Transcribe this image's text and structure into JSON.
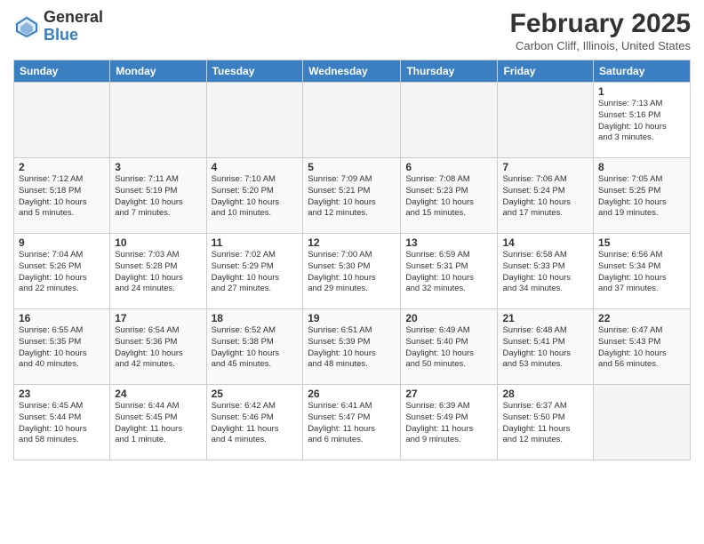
{
  "logo": {
    "general": "General",
    "blue": "Blue"
  },
  "title": {
    "month": "February 2025",
    "location": "Carbon Cliff, Illinois, United States"
  },
  "headers": [
    "Sunday",
    "Monday",
    "Tuesday",
    "Wednesday",
    "Thursday",
    "Friday",
    "Saturday"
  ],
  "weeks": [
    [
      {
        "num": "",
        "info": ""
      },
      {
        "num": "",
        "info": ""
      },
      {
        "num": "",
        "info": ""
      },
      {
        "num": "",
        "info": ""
      },
      {
        "num": "",
        "info": ""
      },
      {
        "num": "",
        "info": ""
      },
      {
        "num": "1",
        "info": "Sunrise: 7:13 AM\nSunset: 5:16 PM\nDaylight: 10 hours\nand 3 minutes."
      }
    ],
    [
      {
        "num": "2",
        "info": "Sunrise: 7:12 AM\nSunset: 5:18 PM\nDaylight: 10 hours\nand 5 minutes."
      },
      {
        "num": "3",
        "info": "Sunrise: 7:11 AM\nSunset: 5:19 PM\nDaylight: 10 hours\nand 7 minutes."
      },
      {
        "num": "4",
        "info": "Sunrise: 7:10 AM\nSunset: 5:20 PM\nDaylight: 10 hours\nand 10 minutes."
      },
      {
        "num": "5",
        "info": "Sunrise: 7:09 AM\nSunset: 5:21 PM\nDaylight: 10 hours\nand 12 minutes."
      },
      {
        "num": "6",
        "info": "Sunrise: 7:08 AM\nSunset: 5:23 PM\nDaylight: 10 hours\nand 15 minutes."
      },
      {
        "num": "7",
        "info": "Sunrise: 7:06 AM\nSunset: 5:24 PM\nDaylight: 10 hours\nand 17 minutes."
      },
      {
        "num": "8",
        "info": "Sunrise: 7:05 AM\nSunset: 5:25 PM\nDaylight: 10 hours\nand 19 minutes."
      }
    ],
    [
      {
        "num": "9",
        "info": "Sunrise: 7:04 AM\nSunset: 5:26 PM\nDaylight: 10 hours\nand 22 minutes."
      },
      {
        "num": "10",
        "info": "Sunrise: 7:03 AM\nSunset: 5:28 PM\nDaylight: 10 hours\nand 24 minutes."
      },
      {
        "num": "11",
        "info": "Sunrise: 7:02 AM\nSunset: 5:29 PM\nDaylight: 10 hours\nand 27 minutes."
      },
      {
        "num": "12",
        "info": "Sunrise: 7:00 AM\nSunset: 5:30 PM\nDaylight: 10 hours\nand 29 minutes."
      },
      {
        "num": "13",
        "info": "Sunrise: 6:59 AM\nSunset: 5:31 PM\nDaylight: 10 hours\nand 32 minutes."
      },
      {
        "num": "14",
        "info": "Sunrise: 6:58 AM\nSunset: 5:33 PM\nDaylight: 10 hours\nand 34 minutes."
      },
      {
        "num": "15",
        "info": "Sunrise: 6:56 AM\nSunset: 5:34 PM\nDaylight: 10 hours\nand 37 minutes."
      }
    ],
    [
      {
        "num": "16",
        "info": "Sunrise: 6:55 AM\nSunset: 5:35 PM\nDaylight: 10 hours\nand 40 minutes."
      },
      {
        "num": "17",
        "info": "Sunrise: 6:54 AM\nSunset: 5:36 PM\nDaylight: 10 hours\nand 42 minutes."
      },
      {
        "num": "18",
        "info": "Sunrise: 6:52 AM\nSunset: 5:38 PM\nDaylight: 10 hours\nand 45 minutes."
      },
      {
        "num": "19",
        "info": "Sunrise: 6:51 AM\nSunset: 5:39 PM\nDaylight: 10 hours\nand 48 minutes."
      },
      {
        "num": "20",
        "info": "Sunrise: 6:49 AM\nSunset: 5:40 PM\nDaylight: 10 hours\nand 50 minutes."
      },
      {
        "num": "21",
        "info": "Sunrise: 6:48 AM\nSunset: 5:41 PM\nDaylight: 10 hours\nand 53 minutes."
      },
      {
        "num": "22",
        "info": "Sunrise: 6:47 AM\nSunset: 5:43 PM\nDaylight: 10 hours\nand 56 minutes."
      }
    ],
    [
      {
        "num": "23",
        "info": "Sunrise: 6:45 AM\nSunset: 5:44 PM\nDaylight: 10 hours\nand 58 minutes."
      },
      {
        "num": "24",
        "info": "Sunrise: 6:44 AM\nSunset: 5:45 PM\nDaylight: 11 hours\nand 1 minute."
      },
      {
        "num": "25",
        "info": "Sunrise: 6:42 AM\nSunset: 5:46 PM\nDaylight: 11 hours\nand 4 minutes."
      },
      {
        "num": "26",
        "info": "Sunrise: 6:41 AM\nSunset: 5:47 PM\nDaylight: 11 hours\nand 6 minutes."
      },
      {
        "num": "27",
        "info": "Sunrise: 6:39 AM\nSunset: 5:49 PM\nDaylight: 11 hours\nand 9 minutes."
      },
      {
        "num": "28",
        "info": "Sunrise: 6:37 AM\nSunset: 5:50 PM\nDaylight: 11 hours\nand 12 minutes."
      },
      {
        "num": "",
        "info": ""
      }
    ]
  ]
}
